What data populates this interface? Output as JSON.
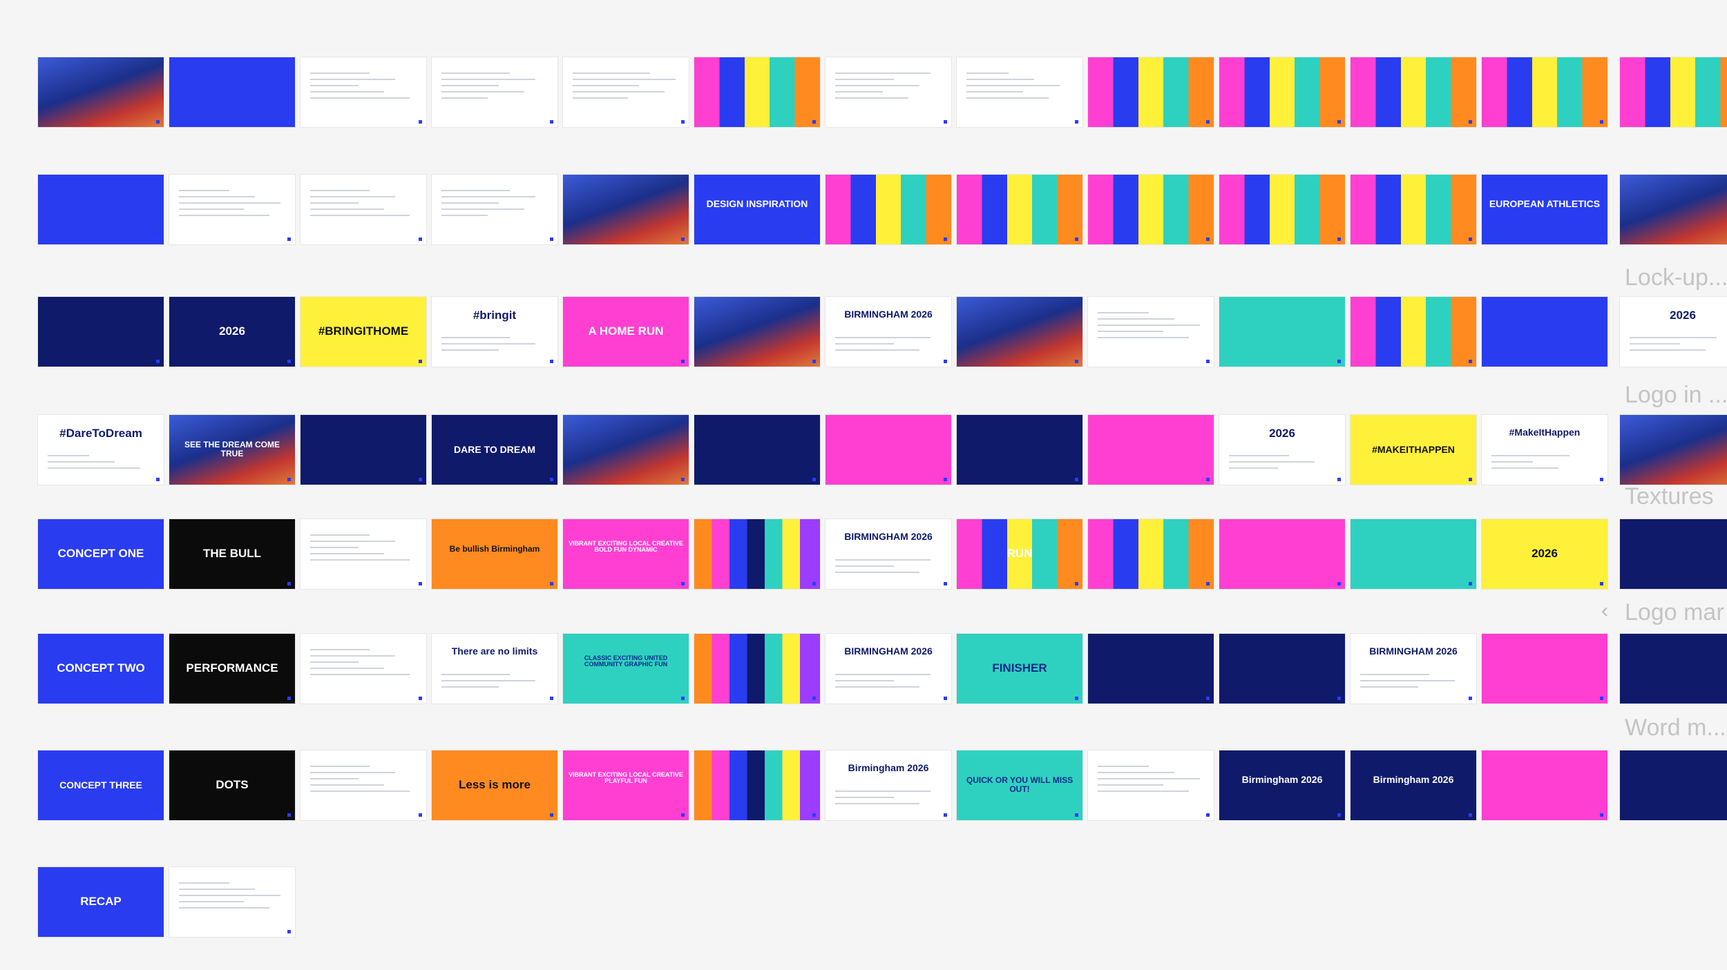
{
  "side_labels": [
    "Lock-up...",
    "Logo in ...",
    "Textures",
    "Logo mar",
    "Word m..."
  ],
  "side_chevron": "‹",
  "colors": {
    "blue": "#2a3cf0",
    "black": "#0b0b0b",
    "orange": "#ff8a1f",
    "magenta": "#ff3fd2",
    "teal": "#2ed1c0",
    "yellow": "#fff03a",
    "navy": "#0f1a6b",
    "white": "#ffffff",
    "grey": "#e9e9ec"
  },
  "rows": [
    [
      {
        "s": "photo"
      },
      {
        "s": "blue"
      },
      {
        "s": "doc"
      },
      {
        "s": "doc"
      },
      {
        "s": "doc"
      },
      {
        "s": "collage"
      },
      {
        "s": "doc"
      },
      {
        "s": "doc"
      },
      {
        "s": "collage"
      },
      {
        "s": "collage"
      },
      {
        "s": "collage"
      },
      {
        "s": "collage"
      },
      {
        "s": "collage"
      }
    ],
    [
      {
        "s": "blue"
      },
      {
        "s": "doc"
      },
      {
        "s": "doc"
      },
      {
        "s": "doc"
      },
      {
        "s": "photo"
      },
      {
        "s": "blue",
        "t": "DESIGN INSPIRATION"
      },
      {
        "s": "collage"
      },
      {
        "s": "collage"
      },
      {
        "s": "collage"
      },
      {
        "s": "collage"
      },
      {
        "s": "collage"
      },
      {
        "s": "blue",
        "t": "EUROPEAN ATHLETICS"
      },
      {
        "s": "photo"
      }
    ],
    [
      {
        "s": "navy"
      },
      {
        "s": "navy",
        "t": "2026"
      },
      {
        "s": "yellow",
        "t": "#BRINGITHOME"
      },
      {
        "s": "doc",
        "t": "#bringit"
      },
      {
        "s": "magenta",
        "t": "A HOME RUN"
      },
      {
        "s": "photo"
      },
      {
        "s": "doc",
        "t": "BIRMINGHAM 2026"
      },
      {
        "s": "photo"
      },
      {
        "s": "doc"
      },
      {
        "s": "teal"
      },
      {
        "s": "collage"
      },
      {
        "s": "blue"
      },
      {
        "s": "doc",
        "t": "2026"
      }
    ],
    [
      {
        "s": "doc",
        "t": "#DareToDream"
      },
      {
        "s": "photo",
        "t": "SEE THE DREAM COME TRUE"
      },
      {
        "s": "navy"
      },
      {
        "s": "navy",
        "t": "DARE TO DREAM"
      },
      {
        "s": "photo"
      },
      {
        "s": "navy"
      },
      {
        "s": "magenta"
      },
      {
        "s": "navy"
      },
      {
        "s": "magenta"
      },
      {
        "s": "doc",
        "t": "2026"
      },
      {
        "s": "yellow",
        "t": "#MAKEITHAPPEN"
      },
      {
        "s": "doc",
        "t": "#MakeItHappen"
      },
      {
        "s": "photo"
      }
    ],
    [
      {
        "s": "blue",
        "t": "CONCEPT ONE"
      },
      {
        "s": "black",
        "t": "THE BULL"
      },
      {
        "s": "doc"
      },
      {
        "s": "orange",
        "t": "Be bullish Birmingham"
      },
      {
        "s": "magenta",
        "t": "VIBRANT EXCITING LOCAL CREATIVE BOLD FUN DYNAMIC"
      },
      {
        "s": "stripes"
      },
      {
        "s": "doc",
        "t": "BIRMINGHAM 2026"
      },
      {
        "s": "collage",
        "t": "RUN"
      },
      {
        "s": "collage"
      },
      {
        "s": "magenta"
      },
      {
        "s": "teal"
      },
      {
        "s": "yellow",
        "t": "2026"
      },
      {
        "s": "navy"
      }
    ],
    [
      {
        "s": "blue",
        "t": "CONCEPT TWO"
      },
      {
        "s": "black",
        "t": "PERFORMANCE"
      },
      {
        "s": "doc"
      },
      {
        "s": "doc",
        "t": "There are no limits"
      },
      {
        "s": "teal",
        "t": "CLASSIC EXCITING UNITED COMMUNITY GRAPHIC FUN"
      },
      {
        "s": "stripes"
      },
      {
        "s": "doc",
        "t": "BIRMINGHAM 2026"
      },
      {
        "s": "teal",
        "t": "FINISHER"
      },
      {
        "s": "navy"
      },
      {
        "s": "navy"
      },
      {
        "s": "doc",
        "t": "BIRMINGHAM 2026"
      },
      {
        "s": "magenta"
      },
      {
        "s": "navy"
      }
    ],
    [
      {
        "s": "blue",
        "t": "CONCEPT THREE"
      },
      {
        "s": "black",
        "t": "DOTS"
      },
      {
        "s": "doc"
      },
      {
        "s": "orange",
        "t": "Less is more"
      },
      {
        "s": "magenta",
        "t": "VIBRANT EXCITING LOCAL CREATIVE PLAYFUL FUN"
      },
      {
        "s": "stripes"
      },
      {
        "s": "doc",
        "t": "Birmingham 2026"
      },
      {
        "s": "teal",
        "t": "QUICK OR YOU WILL MISS OUT!"
      },
      {
        "s": "doc"
      },
      {
        "s": "navy",
        "t": "Birmingham 2026"
      },
      {
        "s": "navy",
        "t": "Birmingham 2026"
      },
      {
        "s": "magenta"
      },
      {
        "s": "navy"
      }
    ],
    [
      {
        "s": "blue",
        "t": "RECAP"
      },
      {
        "s": "doc"
      }
    ]
  ]
}
